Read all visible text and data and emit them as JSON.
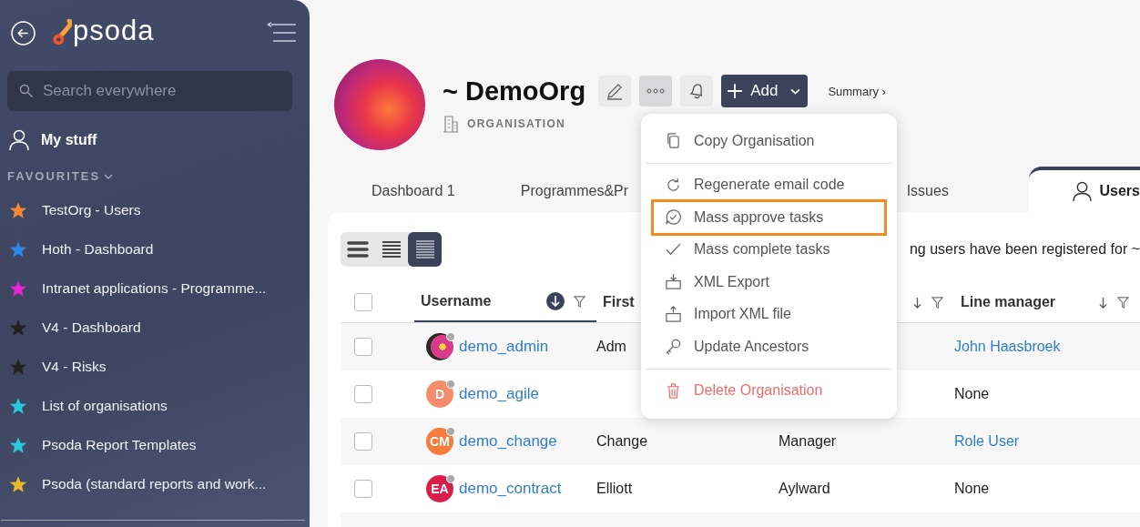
{
  "sidebar": {
    "logo_text": "psoda",
    "search": {
      "placeholder": "Search everywhere"
    },
    "my_stuff": "My stuff",
    "favourites_heading": "FAVOURITES",
    "favourites": [
      {
        "label": "TestOrg - Users",
        "color": "#f5873a"
      },
      {
        "label": "Hoth - Dashboard",
        "color": "#2f86e8"
      },
      {
        "label": "Intranet applications - Programme...",
        "color": "#e524d2"
      },
      {
        "label": "V4 - Dashboard",
        "color": "#222222"
      },
      {
        "label": "V4 - Risks",
        "color": "#222222"
      },
      {
        "label": "List of organisations",
        "color": "#2cc8de"
      },
      {
        "label": "Psoda Report Templates",
        "color": "#2cc8de"
      },
      {
        "label": "Psoda (standard reports and work...",
        "color": "#e8b92a"
      }
    ]
  },
  "header": {
    "title": "~ DemoOrg",
    "type_label": "ORGANISATION",
    "add_button": "Add",
    "summary_link": "Summary ›",
    "more_open": true
  },
  "tabs": [
    {
      "label": "Dashboard 1",
      "selected": false
    },
    {
      "label": "Programmes&Pr",
      "selected": false
    },
    {
      "label": "Issues",
      "selected": false
    },
    {
      "label": "Users",
      "selected": true
    }
  ],
  "view_modes": [
    {
      "kind": "comfortable",
      "selected": false
    },
    {
      "kind": "compact",
      "selected": false
    },
    {
      "kind": "dense",
      "selected": true
    }
  ],
  "intro_text": "ng users have been registered for ~",
  "table": {
    "header_checked": false,
    "columns": [
      {
        "label": "Username",
        "sort_active": true
      },
      {
        "label": "First"
      },
      {
        "sort_active": false
      },
      {
        "label": "Line manager",
        "sort_active": false
      }
    ],
    "rows": [
      {
        "checked": false,
        "avatar": {
          "kind": "photo"
        },
        "username": "demo_admin",
        "first_name": "Adm",
        "line_manager": {
          "text": "John Haasbroek",
          "link": true
        }
      },
      {
        "checked": false,
        "avatar": {
          "kind": "initials",
          "initials": "D",
          "color": "#f78c6c"
        },
        "username": "demo_agile",
        "line_manager": {
          "text": "None",
          "link": false
        }
      },
      {
        "checked": false,
        "avatar": {
          "kind": "initials",
          "initials": "CM",
          "color": "#f47c3c"
        },
        "username": "demo_change",
        "first_name": "Change",
        "last_name": "Manager",
        "line_manager": {
          "text": "Role User",
          "link": true
        }
      },
      {
        "checked": false,
        "avatar": {
          "kind": "initials",
          "initials": "EA",
          "color": "#d6204a"
        },
        "username": "demo_contract",
        "first_name": "Elliott",
        "last_name": "Aylward",
        "line_manager": {
          "text": "None",
          "link": false
        }
      }
    ]
  },
  "menu": {
    "items": [
      {
        "kind": "item",
        "label": "Copy Organisation",
        "highlighted": false
      },
      {
        "kind": "divider"
      },
      {
        "kind": "item",
        "label": "Regenerate email code",
        "highlighted": false
      },
      {
        "kind": "item",
        "label": "Mass approve tasks",
        "highlighted": true
      },
      {
        "kind": "item",
        "label": "Mass complete tasks",
        "highlighted": false
      },
      {
        "kind": "item",
        "label": "XML Export",
        "highlighted": false
      },
      {
        "kind": "item",
        "label": "Import XML file",
        "highlighted": false
      },
      {
        "kind": "item",
        "label": "Update Ancestors",
        "highlighted": false
      },
      {
        "kind": "divider"
      },
      {
        "kind": "danger",
        "label": "Delete Organisation",
        "highlighted": false
      }
    ]
  }
}
